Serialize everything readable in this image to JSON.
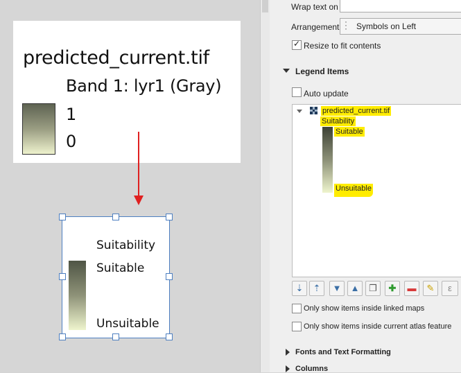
{
  "legend_before": {
    "title": "predicted_current.tif",
    "band": "Band 1: lyr1 (Gray)",
    "max_label": "1",
    "min_label": "0"
  },
  "legend_after": {
    "title": "Suitability",
    "high_label": "Suitable",
    "low_label": "Unsuitable"
  },
  "panel": {
    "wrap_text_label": "Wrap text on",
    "wrap_text_value": "",
    "arrangement_label": "Arrangement",
    "arrangement_value": "Symbols on Left",
    "resize_label": "Resize to fit contents",
    "legend_items_header": "Legend Items",
    "auto_update_label": "Auto update",
    "tree": {
      "layer_name": "predicted_current.tif",
      "group_label": "Suitability",
      "high_label": "Suitable",
      "low_label": "Unsuitable"
    },
    "toolbar_icons": [
      "filter-legend-icon",
      "move-up-icon",
      "down-arrow-icon",
      "up-arrow-icon",
      "add-group-icon",
      "add-item-icon",
      "remove-item-icon",
      "edit-item-icon",
      "expression-icon"
    ],
    "expression_glyph": "ε",
    "linked_maps_label": "Only show items inside linked maps",
    "atlas_label": "Only show items inside current atlas feature",
    "fonts_header": "Fonts and Text Formatting",
    "columns_header": "Columns"
  },
  "colors": {
    "highlight": "#ffec00",
    "arrow": "#e02020",
    "selection": "#4d7fc1"
  }
}
